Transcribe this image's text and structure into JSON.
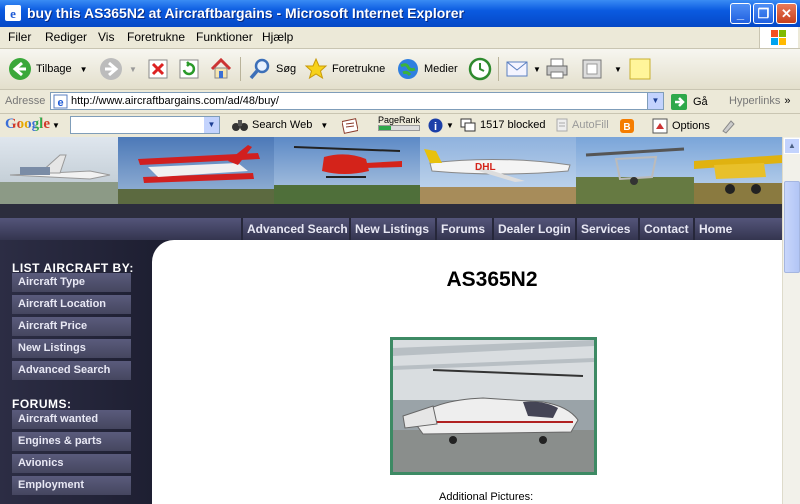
{
  "window": {
    "title": "buy this AS365N2 at Aircraftbargains - Microsoft Internet Explorer"
  },
  "menu": [
    "Filer",
    "Rediger",
    "Vis",
    "Foretrukne",
    "Funktioner",
    "Hjælp"
  ],
  "toolbar": {
    "back": "Tilbage",
    "search": "Søg",
    "favorites": "Foretrukne",
    "media": "Medier"
  },
  "address": {
    "label": "Adresse",
    "url": "http://www.aircraftbargains.com/ad/48/buy/",
    "go": "Gå",
    "links": "Hyperlinks"
  },
  "google": {
    "logo": "Google",
    "search_web": "Search Web",
    "pagerank": "PageRank",
    "blocked": "1517 blocked",
    "autofill": "AutoFill",
    "options": "Options"
  },
  "nav": [
    "Advanced Search",
    "New Listings",
    "Forums",
    "Dealer Login",
    "Services",
    "Contact",
    "Home"
  ],
  "sidebar": {
    "list_heading": "LIST AIRCRAFT BY:",
    "list_items": [
      "Aircraft Type",
      "Aircraft Location",
      "Aircraft Price",
      "New Listings",
      "Advanced Search"
    ],
    "forums_heading": "FORUMS:",
    "forum_items": [
      "Aircraft wanted",
      "Engines & parts",
      "Avionics",
      "Employment"
    ]
  },
  "ad": {
    "title": "AS365N2",
    "additional_pictures": "Additional Pictures:"
  },
  "colors": {
    "titlebar": "#0a5ae0",
    "sidebar": "#23243a",
    "nav": "#45466a",
    "photo_border": "#3d8a64"
  }
}
